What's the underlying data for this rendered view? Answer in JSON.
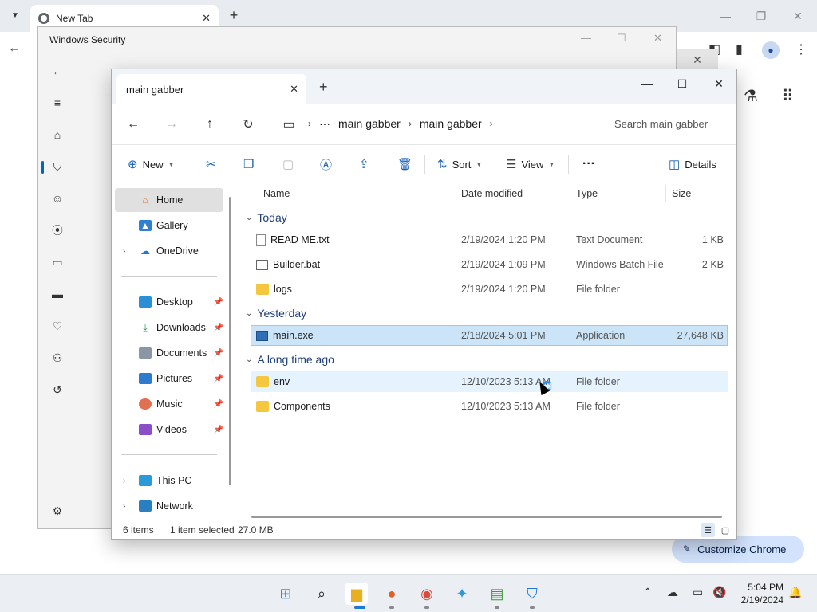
{
  "chrome": {
    "tab_title": "New Tab",
    "new_tab_symbol": "+",
    "customize_label": "Customize Chrome",
    "icons": [
      "tab-list-icon",
      "chrome-logo-icon",
      "close-icon",
      "back-icon",
      "side-panel-icon",
      "profile-icon",
      "more-icon",
      "labs-icon",
      "apps-icon"
    ]
  },
  "windows_security": {
    "title": "Windows Security",
    "nav_icons": [
      "back-icon",
      "menu-icon",
      "home-icon",
      "shield-icon",
      "account-icon",
      "firewall-icon",
      "app-browser-icon",
      "device-security-icon",
      "device-health-icon",
      "family-icon",
      "history-icon",
      "settings-icon"
    ]
  },
  "explorer": {
    "tab_title": "main gabber",
    "breadcrumb": [
      "main gabber",
      "main gabber"
    ],
    "search_placeholder": "Search main gabber",
    "commands": {
      "new": "New",
      "sort": "Sort",
      "view": "View",
      "more": "···",
      "details": "Details"
    },
    "sidebar": {
      "top": [
        {
          "label": "Home",
          "active": true
        },
        {
          "label": "Gallery"
        },
        {
          "label": "OneDrive",
          "expandable": true
        }
      ],
      "pinned": [
        {
          "label": "Desktop"
        },
        {
          "label": "Downloads"
        },
        {
          "label": "Documents"
        },
        {
          "label": "Pictures"
        },
        {
          "label": "Music"
        },
        {
          "label": "Videos"
        }
      ],
      "bottom": [
        {
          "label": "This PC"
        },
        {
          "label": "Network"
        }
      ]
    },
    "columns": {
      "name": "Name",
      "date": "Date modified",
      "type": "Type",
      "size": "Size"
    },
    "groups": [
      {
        "label": "Today",
        "files": [
          {
            "name": "READ ME.txt",
            "date": "2/19/2024 1:20 PM",
            "type": "Text Document",
            "size": "1 KB",
            "icon": "text-file-icon"
          },
          {
            "name": "Builder.bat",
            "date": "2/19/2024 1:09 PM",
            "type": "Windows Batch File",
            "size": "2 KB",
            "icon": "batch-file-icon"
          },
          {
            "name": "logs",
            "date": "2/19/2024 1:20 PM",
            "type": "File folder",
            "size": "",
            "icon": "folder-icon"
          }
        ]
      },
      {
        "label": "Yesterday",
        "files": [
          {
            "name": "main.exe",
            "date": "2/18/2024 5:01 PM",
            "type": "Application",
            "size": "27,648 KB",
            "icon": "exe-file-icon",
            "selected": true
          }
        ]
      },
      {
        "label": "A long time ago",
        "files": [
          {
            "name": "env",
            "date": "12/10/2023 5:13 AM",
            "type": "File folder",
            "size": "",
            "icon": "folder-icon",
            "hover": true
          },
          {
            "name": "Components",
            "date": "12/10/2023 5:13 AM",
            "type": "File folder",
            "size": "",
            "icon": "folder-icon"
          }
        ]
      }
    ],
    "status": {
      "items": "6 items",
      "selected": "1 item selected",
      "size": "27.0 MB"
    }
  },
  "taskbar": {
    "apps": [
      "start-icon",
      "search-icon",
      "file-explorer-icon",
      "firefox-icon",
      "chrome-icon",
      "network-app-icon",
      "notepad-app-icon",
      "defender-icon"
    ],
    "time": "5:04 PM",
    "date": "2/19/2024"
  },
  "colors": {
    "accent": "#0067c0",
    "selection": "#cce4f7",
    "folder": "#f4c73e"
  }
}
